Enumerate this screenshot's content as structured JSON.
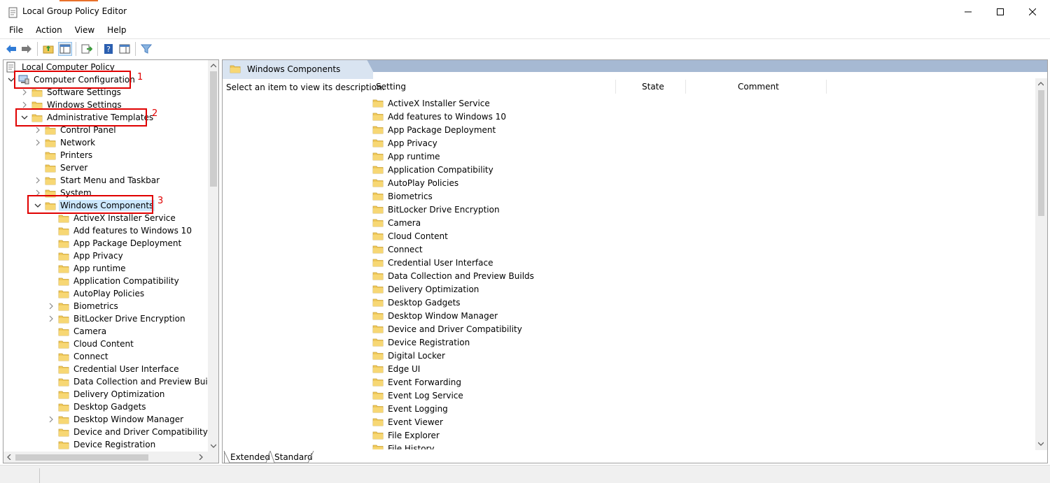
{
  "window": {
    "title": "Local Group Policy Editor"
  },
  "menu": [
    "File",
    "Action",
    "View",
    "Help"
  ],
  "toolbar": {
    "icons": [
      "back-arrow-icon",
      "forward-arrow-icon",
      "up-folder-icon",
      "show-hide-tree-icon",
      "export-list-icon",
      "help-icon",
      "properties-pane-icon",
      "filter-icon"
    ]
  },
  "tree": {
    "root": "Local Computer Policy",
    "computer_configuration": "Computer Configuration",
    "software_settings": "Software Settings",
    "windows_settings": "Windows Settings",
    "administrative_templates": "Administrative Templates",
    "control_panel": "Control Panel",
    "network": "Network",
    "printers": "Printers",
    "server": "Server",
    "start_menu": "Start Menu and Taskbar",
    "system": "System",
    "windows_components": "Windows Components",
    "wc_children": [
      {
        "label": "ActiveX Installer Service",
        "expandable": false
      },
      {
        "label": "Add features to Windows 10",
        "expandable": false
      },
      {
        "label": "App Package Deployment",
        "expandable": false
      },
      {
        "label": "App Privacy",
        "expandable": false
      },
      {
        "label": "App runtime",
        "expandable": false
      },
      {
        "label": "Application Compatibility",
        "expandable": false
      },
      {
        "label": "AutoPlay Policies",
        "expandable": false
      },
      {
        "label": "Biometrics",
        "expandable": true
      },
      {
        "label": "BitLocker Drive Encryption",
        "expandable": true
      },
      {
        "label": "Camera",
        "expandable": false
      },
      {
        "label": "Cloud Content",
        "expandable": false
      },
      {
        "label": "Connect",
        "expandable": false
      },
      {
        "label": "Credential User Interface",
        "expandable": false
      },
      {
        "label": "Data Collection and Preview Builds",
        "expandable": false
      },
      {
        "label": "Delivery Optimization",
        "expandable": false
      },
      {
        "label": "Desktop Gadgets",
        "expandable": false
      },
      {
        "label": "Desktop Window Manager",
        "expandable": true
      },
      {
        "label": "Device and Driver Compatibility",
        "expandable": false
      },
      {
        "label": "Device Registration",
        "expandable": false
      }
    ]
  },
  "annotations": [
    "1",
    "2",
    "3"
  ],
  "right": {
    "header": "Windows Components",
    "description": "Select an item to view its description.",
    "columns": {
      "setting": "Setting",
      "state": "State",
      "comment": "Comment"
    },
    "settings": [
      "ActiveX Installer Service",
      "Add features to Windows 10",
      "App Package Deployment",
      "App Privacy",
      "App runtime",
      "Application Compatibility",
      "AutoPlay Policies",
      "Biometrics",
      "BitLocker Drive Encryption",
      "Camera",
      "Cloud Content",
      "Connect",
      "Credential User Interface",
      "Data Collection and Preview Builds",
      "Delivery Optimization",
      "Desktop Gadgets",
      "Desktop Window Manager",
      "Device and Driver Compatibility",
      "Device Registration",
      "Digital Locker",
      "Edge UI",
      "Event Forwarding",
      "Event Log Service",
      "Event Logging",
      "Event Viewer",
      "File Explorer",
      "File History"
    ],
    "tabs": [
      "Extended",
      "Standard"
    ]
  },
  "colors": {
    "annotation": "#e00000",
    "selection": "#cce8ff",
    "header_band": "#a6b9d3",
    "folder": "#f0c95a"
  }
}
